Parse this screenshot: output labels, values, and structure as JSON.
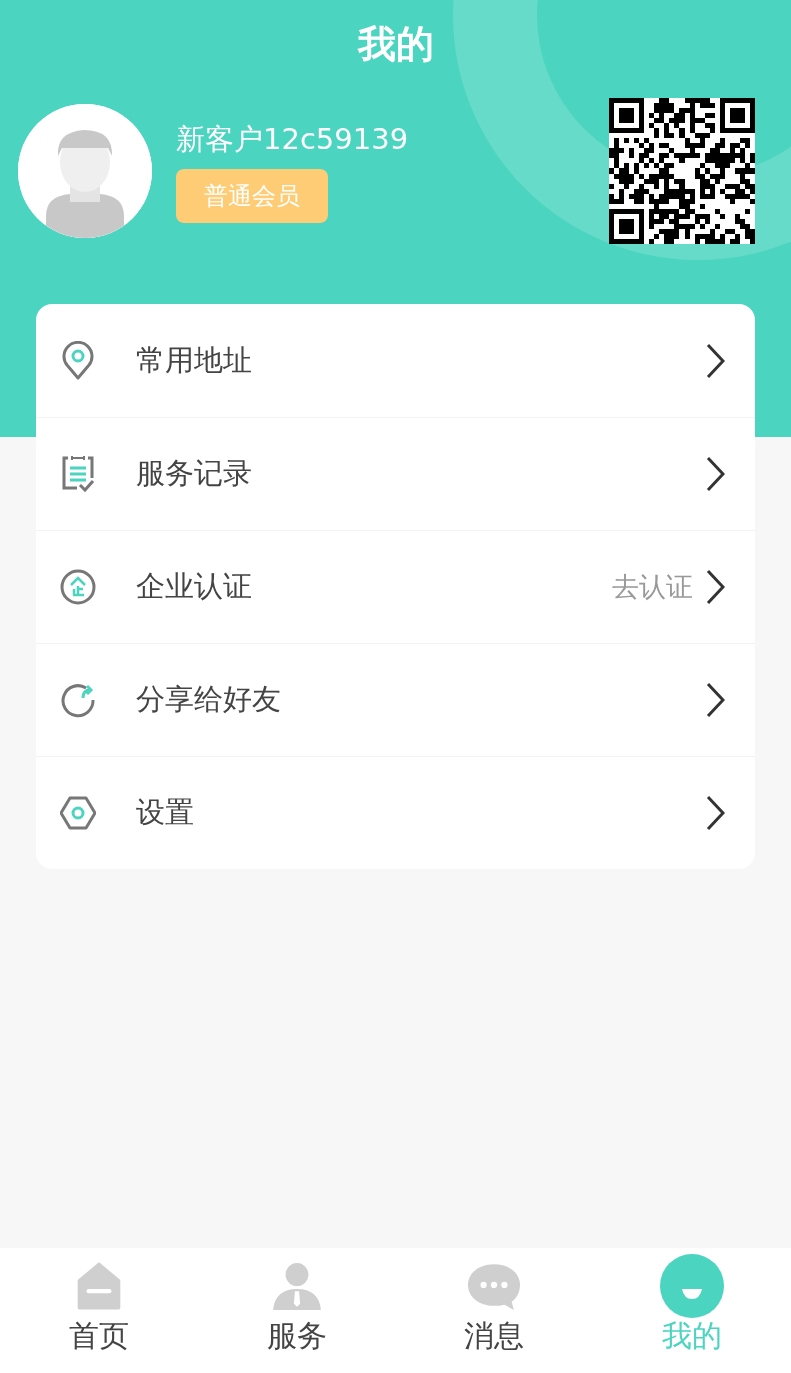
{
  "header": {
    "title": "我的"
  },
  "profile": {
    "name": "新客户12c59139",
    "member_badge": "普通会员"
  },
  "menu": [
    {
      "label": "常用地址"
    },
    {
      "label": "服务记录"
    },
    {
      "label": "企业认证",
      "hint": "去认证"
    },
    {
      "label": "分享给好友"
    },
    {
      "label": "设置"
    }
  ],
  "tabs": [
    {
      "label": "首页",
      "selected": false
    },
    {
      "label": "服务",
      "selected": false
    },
    {
      "label": "消息",
      "selected": false
    },
    {
      "label": "我的",
      "selected": true
    }
  ]
}
